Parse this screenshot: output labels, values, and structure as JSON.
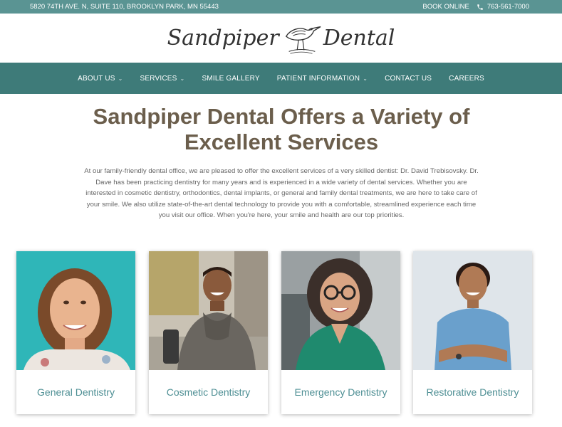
{
  "topbar": {
    "address": "5820 74TH AVE. N, SUITE 110, BROOKLYN PARK, MN 55443",
    "book_online": "BOOK ONLINE",
    "phone": "763-561-7000"
  },
  "logo": {
    "left": "Sandpiper",
    "right": "Dental"
  },
  "nav": {
    "items": [
      {
        "label": "ABOUT US",
        "dropdown": true
      },
      {
        "label": "SERVICES",
        "dropdown": true
      },
      {
        "label": "SMILE GALLERY",
        "dropdown": false
      },
      {
        "label": "PATIENT INFORMATION",
        "dropdown": true
      },
      {
        "label": "CONTACT US",
        "dropdown": false
      },
      {
        "label": "CAREERS",
        "dropdown": false
      }
    ]
  },
  "main": {
    "heading": "Sandpiper Dental Offers a Variety of Excellent Services",
    "intro": "At our family-friendly dental office, we are pleased to offer the excellent services of a very skilled dentist: Dr. David Trebisovsky. Dr. Dave has been practicing dentistry for many years and is experienced in a wide variety of dental services. Whether you are interested in cosmetic dentistry, orthodontics, dental implants, or general and family dental treatments, we are here to take care of your smile. We also utilize state-of-the-art dental technology to provide you with a comfortable, streamlined experience each time you visit our office. When you're here, your smile and health are our top priorities."
  },
  "cards": [
    {
      "label": "General Dentistry"
    },
    {
      "label": "Cosmetic Dentistry"
    },
    {
      "label": "Emergency Dentistry"
    },
    {
      "label": "Restorative Dentistry"
    }
  ],
  "colors": {
    "topbar": "#5a9493",
    "nav": "#3e7b79",
    "heading": "#6b5e4c",
    "card_label": "#4e8f94"
  }
}
